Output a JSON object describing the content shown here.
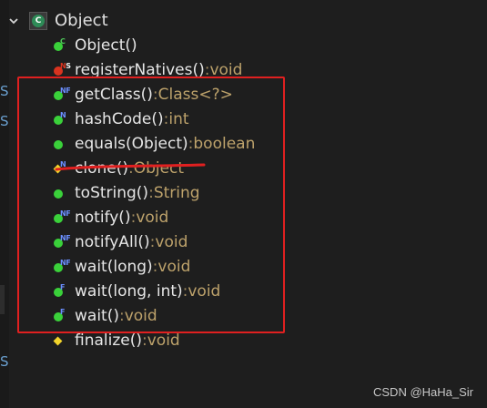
{
  "outline": {
    "root": {
      "label": "Object",
      "badge": "C",
      "expand_icon": "chevron-down-icon"
    },
    "members": [
      {
        "name": "Object()",
        "type": "",
        "icon": "public-method-icon",
        "modifiers": "C"
      },
      {
        "name": "registerNatives()",
        "type": "void",
        "icon": "private-method-icon",
        "modifiers": "NS"
      },
      {
        "name": "getClass()",
        "type": "Class<?>",
        "icon": "public-method-icon",
        "modifiers": "NF"
      },
      {
        "name": "hashCode()",
        "type": "int",
        "icon": "public-method-icon",
        "modifiers": "N"
      },
      {
        "name": "equals(Object)",
        "type": "boolean",
        "icon": "public-method-icon",
        "modifiers": ""
      },
      {
        "name": "clone()",
        "type": "Object",
        "icon": "protected-method-icon",
        "modifiers": "N"
      },
      {
        "name": "toString()",
        "type": "String",
        "icon": "public-method-icon",
        "modifiers": ""
      },
      {
        "name": "notify()",
        "type": "void",
        "icon": "public-method-icon",
        "modifiers": "NF"
      },
      {
        "name": "notifyAll()",
        "type": "void",
        "icon": "public-method-icon",
        "modifiers": "NF"
      },
      {
        "name": "wait(long)",
        "type": "void",
        "icon": "public-method-icon",
        "modifiers": "NF"
      },
      {
        "name": "wait(long, int)",
        "type": "void",
        "icon": "public-method-icon",
        "modifiers": "F"
      },
      {
        "name": "wait()",
        "type": "void",
        "icon": "public-method-icon",
        "modifiers": "F"
      },
      {
        "name": "finalize()",
        "type": "void",
        "icon": "protected-method-icon",
        "modifiers": ""
      }
    ],
    "separator": " : "
  },
  "annotation": {
    "box_color": "#e02020",
    "strike_color": "#e02020"
  },
  "watermark": "CSDN @HaHa_Sir",
  "colors": {
    "background": "#1e1e1e",
    "method_public": "#3ad13a",
    "method_private": "#d9331f",
    "method_protected": "#f2d42b",
    "type_text": "#bda26b"
  }
}
